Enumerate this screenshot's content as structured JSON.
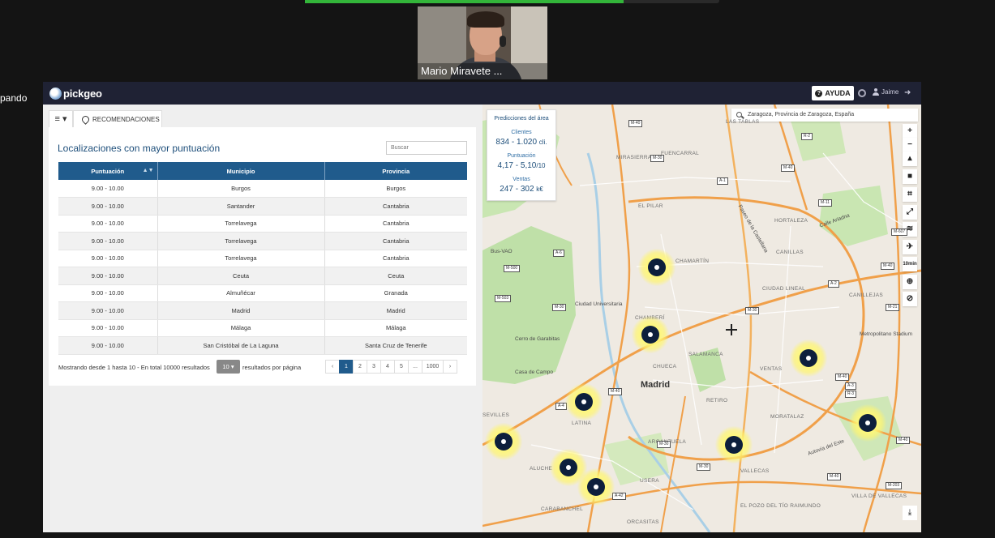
{
  "call": {
    "participant_name": "Mario Miravete ...",
    "side_text": "pando",
    "progress_fraction": 0.77
  },
  "navbar": {
    "logo_text": "pickgeo",
    "help_label": "AYUDA",
    "user_name": "Jaime",
    "help_icon": "question-circle-icon",
    "settings_icon": "gear-icon",
    "user_icon": "user-icon",
    "logout_icon": "logout-icon"
  },
  "left_panel": {
    "menu_label": "≡ ▾",
    "tab_label": "RECOMENDACIONES",
    "title": "Localizaciones con mayor puntuación",
    "search_placeholder": "Buscar",
    "columns": [
      "Puntuación",
      "Municipio",
      "Provincia"
    ],
    "rows": [
      {
        "score": "9.00 - 10.00",
        "municipio": "Burgos",
        "provincia": "Burgos"
      },
      {
        "score": "9.00 - 10.00",
        "municipio": "Santander",
        "provincia": "Cantabria"
      },
      {
        "score": "9.00 - 10.00",
        "municipio": "Torrelavega",
        "provincia": "Cantabria"
      },
      {
        "score": "9.00 - 10.00",
        "municipio": "Torrelavega",
        "provincia": "Cantabria"
      },
      {
        "score": "9.00 - 10.00",
        "municipio": "Torrelavega",
        "provincia": "Cantabria"
      },
      {
        "score": "9.00 - 10.00",
        "municipio": "Ceuta",
        "provincia": "Ceuta"
      },
      {
        "score": "9.00 - 10.00",
        "municipio": "Almuñécar",
        "provincia": "Granada"
      },
      {
        "score": "9.00 - 10.00",
        "municipio": "Madrid",
        "provincia": "Madrid"
      },
      {
        "score": "9.00 - 10.00",
        "municipio": "Málaga",
        "provincia": "Málaga"
      },
      {
        "score": "9.00 - 10.00",
        "municipio": "San Cristóbal de La Laguna",
        "provincia": "Santa Cruz de Tenerife"
      }
    ],
    "footer": {
      "showing_text": "Mostrando desde 1 hasta 10 - En total 10000 resultados",
      "page_size": "10 ▾",
      "per_page_text": "resultados por página",
      "pages": [
        "‹",
        "1",
        "2",
        "3",
        "4",
        "5",
        "...",
        "1000",
        "›"
      ]
    }
  },
  "map": {
    "predictions": {
      "title": "Predicciones del área",
      "clients_label": "Clientes",
      "clients_value": "834 - 1.020",
      "clients_unit": "cli.",
      "score_label": "Puntuación",
      "score_value": "4,17 - 5,10",
      "score_unit": "/10",
      "sales_label": "Ventas",
      "sales_value": "247 - 302",
      "sales_unit": "k€"
    },
    "search_value": "Zaragoza, Provincia de Zaragoza, España",
    "tools": [
      {
        "name": "zoom-in-button",
        "glyph": "+"
      },
      {
        "name": "zoom-out-button",
        "glyph": "−"
      },
      {
        "name": "compass-button",
        "glyph": "▴"
      },
      {
        "name": "lock-button",
        "glyph": "■"
      },
      {
        "name": "crop-button",
        "glyph": "⌗"
      },
      {
        "name": "fullscreen-button",
        "glyph": "⤢"
      },
      {
        "name": "layers-button",
        "glyph": "≋"
      },
      {
        "name": "walk-button",
        "glyph": "✈"
      },
      {
        "name": "isochrone-button",
        "glyph": "10min"
      },
      {
        "name": "globe-button",
        "glyph": "⊕"
      },
      {
        "name": "hide-button",
        "glyph": "⊘"
      }
    ],
    "labels": {
      "madrid": "Madrid",
      "chamartin": "CHAMARTÍN",
      "chamberi": "CHAMBERÍ",
      "salamanca": "SALAMANCA",
      "chueca": "CHUECA",
      "retiro": "RETIRO",
      "latina": "LATINA",
      "arganzuela": "ARGANZUELA",
      "usera": "USERA",
      "carabanchel": "CARABANCHEL",
      "vallecas": "VALLECAS",
      "moratalaz": "MORATALAZ",
      "ventas": "VENTAS",
      "ciudad_lineal": "CIUDAD LINEAL",
      "canillejas": "CANILLEJAS",
      "canillas": "CANILLAS",
      "hortaleza": "HORTALEZA",
      "el_pilar": "EL PILAR",
      "mirasierra": "MIRASIERRA",
      "fuencarral": "FUENCARRAL",
      "las_tablas": "LAS TABLAS",
      "aluche": "ALUCHE",
      "orcasitas": "ORCASITAS",
      "el_pozo": "EL POZO DEL TÍO RAIMUNDO",
      "villa_vallecas": "VILLA DE VALLECAS",
      "sevilles": "SEVILLES",
      "ciudad_universitaria": "Ciudad Universitaria",
      "cerro_garabitas": "Cerro de Garabitas",
      "casa_de_campo": "Casa de Campo",
      "metropolitano": "Metropolitano Stadium",
      "calle_ariadna": "Calle Ariadna",
      "autovia_este": "Autovía del Este",
      "paseo_castellana": "Paseo de la Castellana",
      "bus_vao": "Bus-VAO"
    },
    "road_signs": [
      "M-40",
      "M-30",
      "A-1",
      "M-11",
      "A-2",
      "M-21",
      "M-40",
      "A-6",
      "M-500",
      "M-503",
      "M-30",
      "A-42",
      "M-40",
      "M-203",
      "A-3",
      "M-30",
      "M-30",
      "M-40",
      "R-2",
      "M-607",
      "M-40",
      "M-30",
      "R-3",
      "M-40",
      "A-4",
      "M-40"
    ],
    "download_icon": "download-icon"
  }
}
